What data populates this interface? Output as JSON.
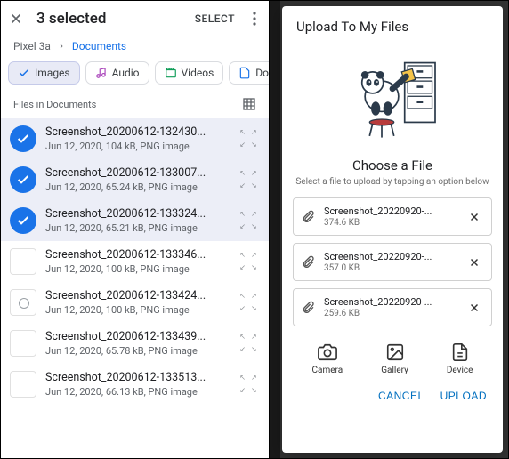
{
  "left": {
    "header_title": "3 selected",
    "select_btn": "SELECT",
    "breadcrumb": {
      "root": "Pixel 3a",
      "current": "Documents"
    },
    "chips": {
      "images": "Images",
      "audio": "Audio",
      "videos": "Videos",
      "docs": "Do"
    },
    "section_label": "Files in Documents",
    "files": [
      {
        "name": "Screenshot_20200612-132430...",
        "meta": "Jun 12, 2020, 104 kB, PNG image",
        "selected": true
      },
      {
        "name": "Screenshot_20200612-133007...",
        "meta": "Jun 12, 2020, 65.24 kB, PNG image",
        "selected": true
      },
      {
        "name": "Screenshot_20200612-133324...",
        "meta": "Jun 12, 2020, 65.21 kB, PNG image",
        "selected": true
      },
      {
        "name": "Screenshot_20200612-133346...",
        "meta": "Jun 12, 2020, 100 kB, PNG image",
        "selected": false
      },
      {
        "name": "Screenshot_20200612-133424...",
        "meta": "Jun 12, 2020, 100 kB, PNG image",
        "selected": false
      },
      {
        "name": "Screenshot_20200612-133439...",
        "meta": "Jun 12, 2020, 65.78 kB, PNG image",
        "selected": false
      },
      {
        "name": "Screenshot_20200612-133513...",
        "meta": "Jun 12, 2020, 66.13 kB, PNG image",
        "selected": false
      }
    ]
  },
  "right": {
    "dialog_title": "Upload To My Files",
    "choose_title": "Choose a File",
    "choose_sub": "Select a file to upload by tapping an option below",
    "uploads": [
      {
        "name": "Screenshot_20220920-...",
        "size": "374.6 KB"
      },
      {
        "name": "Screenshot_20220920-...",
        "size": "357.0 KB"
      },
      {
        "name": "Screenshot_20220920-...",
        "size": "259.6 KB"
      }
    ],
    "sources": {
      "camera": "Camera",
      "gallery": "Gallery",
      "device": "Device"
    },
    "actions": {
      "cancel": "CANCEL",
      "upload": "UPLOAD"
    }
  }
}
